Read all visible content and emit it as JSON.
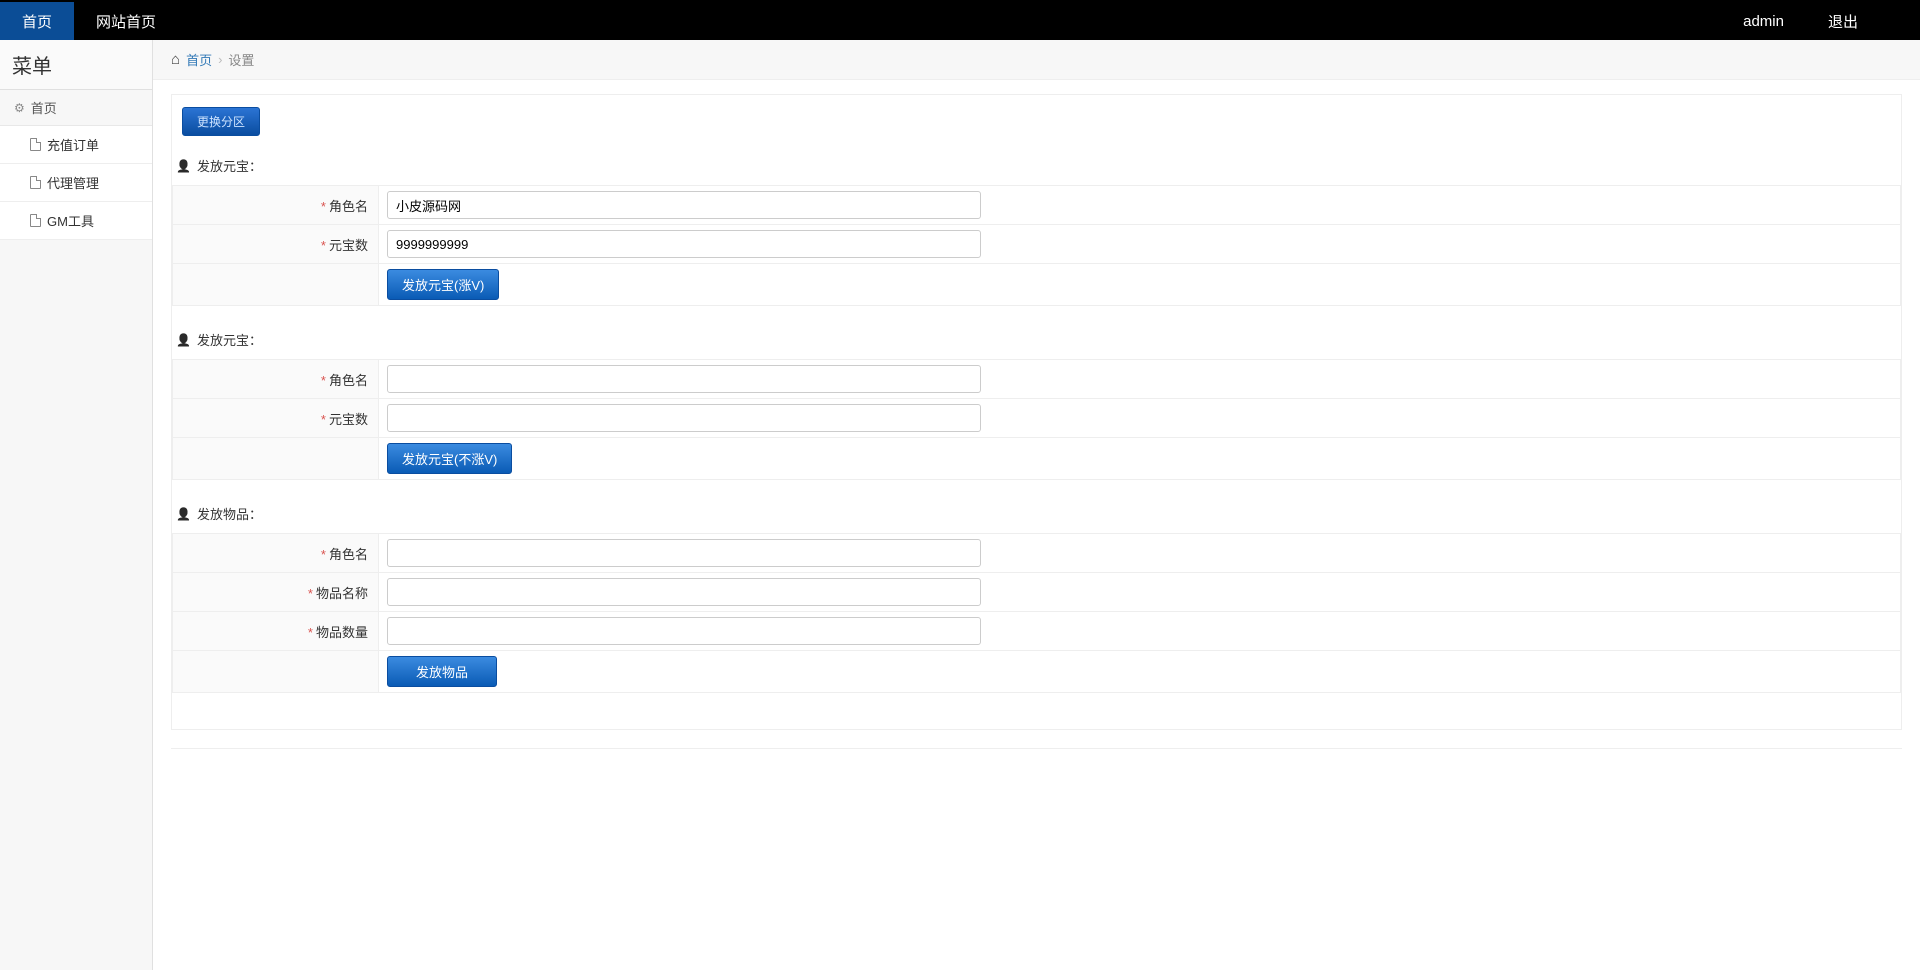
{
  "topnav": {
    "home": "首页",
    "site_home": "网站首页",
    "user": "admin",
    "logout": "退出"
  },
  "sidebar": {
    "title": "菜单",
    "section_home": "首页",
    "items": [
      {
        "label": "充值订单"
      },
      {
        "label": "代理管理"
      },
      {
        "label": "GM工具"
      }
    ]
  },
  "breadcrumb": {
    "home": "首页",
    "current": "设置"
  },
  "buttons": {
    "change_zone": "更换分区"
  },
  "section1": {
    "title": "发放元宝：",
    "field_role": "角色名",
    "field_amount": "元宝数",
    "role_value": "小皮源码网",
    "amount_value": "9999999999",
    "submit": "发放元宝(涨V)"
  },
  "section2": {
    "title": "发放元宝：",
    "field_role": "角色名",
    "field_amount": "元宝数",
    "role_value": "",
    "amount_value": "",
    "submit": "发放元宝(不涨V)"
  },
  "section3": {
    "title": "发放物品：",
    "field_role": "角色名",
    "field_item": "物品名称",
    "field_qty": "物品数量",
    "role_value": "",
    "item_value": "",
    "qty_value": "",
    "submit": "发放物品"
  }
}
